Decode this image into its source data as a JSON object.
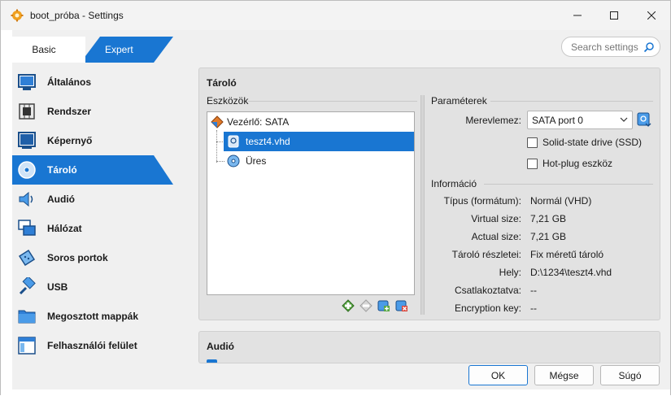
{
  "window": {
    "title": "boot_próba - Settings"
  },
  "mode": {
    "basic_label": "Basic",
    "expert_label": "Expert"
  },
  "search": {
    "placeholder": "Search settings"
  },
  "nav": {
    "items": [
      {
        "label": "Általános",
        "icon": "general-icon"
      },
      {
        "label": "Rendszer",
        "icon": "system-chip-icon"
      },
      {
        "label": "Képernyő",
        "icon": "display-icon"
      },
      {
        "label": "Tároló",
        "icon": "storage-disk-icon",
        "active": true
      },
      {
        "label": "Audió",
        "icon": "speaker-icon"
      },
      {
        "label": "Hálózat",
        "icon": "network-icon"
      },
      {
        "label": "Soros portok",
        "icon": "serial-port-icon"
      },
      {
        "label": "USB",
        "icon": "usb-icon"
      },
      {
        "label": "Megosztott mappák",
        "icon": "shared-folder-icon"
      },
      {
        "label": "Felhasználói felület",
        "icon": "user-interface-icon"
      }
    ]
  },
  "storage": {
    "title": "Tároló",
    "devices_label": "Eszközök",
    "tree": {
      "controller": "Vezérlő: SATA",
      "items": [
        "teszt4.vhd",
        "Üres"
      ]
    },
    "params_label": "Paraméterek",
    "hard_disk_label": "Merevlemez:",
    "hard_disk_value": "SATA port 0",
    "ssd_label": "Solid-state drive (SSD)",
    "hotplug_label": "Hot-plug eszköz",
    "info_label": "Információ",
    "info": [
      {
        "label": "Típus (formátum):",
        "value": "Normál (VHD)"
      },
      {
        "label": "Virtual size:",
        "value": "7,21 GB"
      },
      {
        "label": "Actual size:",
        "value": "7,21 GB"
      },
      {
        "label": "Tároló részletei:",
        "value": "Fix méretű tároló"
      },
      {
        "label": "Hely:",
        "value": "D:\\1234\\teszt4.vhd"
      },
      {
        "label": "Csatlakoztatva:",
        "value": "--"
      },
      {
        "label": "Encryption key:",
        "value": "--"
      }
    ]
  },
  "audio": {
    "title": "Audió"
  },
  "buttons": {
    "ok": "OK",
    "cancel": "Mégse",
    "help": "Súgó"
  },
  "colors": {
    "accent": "#1976d2",
    "panel": "#e2e2e2",
    "window": "#f0f0f0"
  }
}
